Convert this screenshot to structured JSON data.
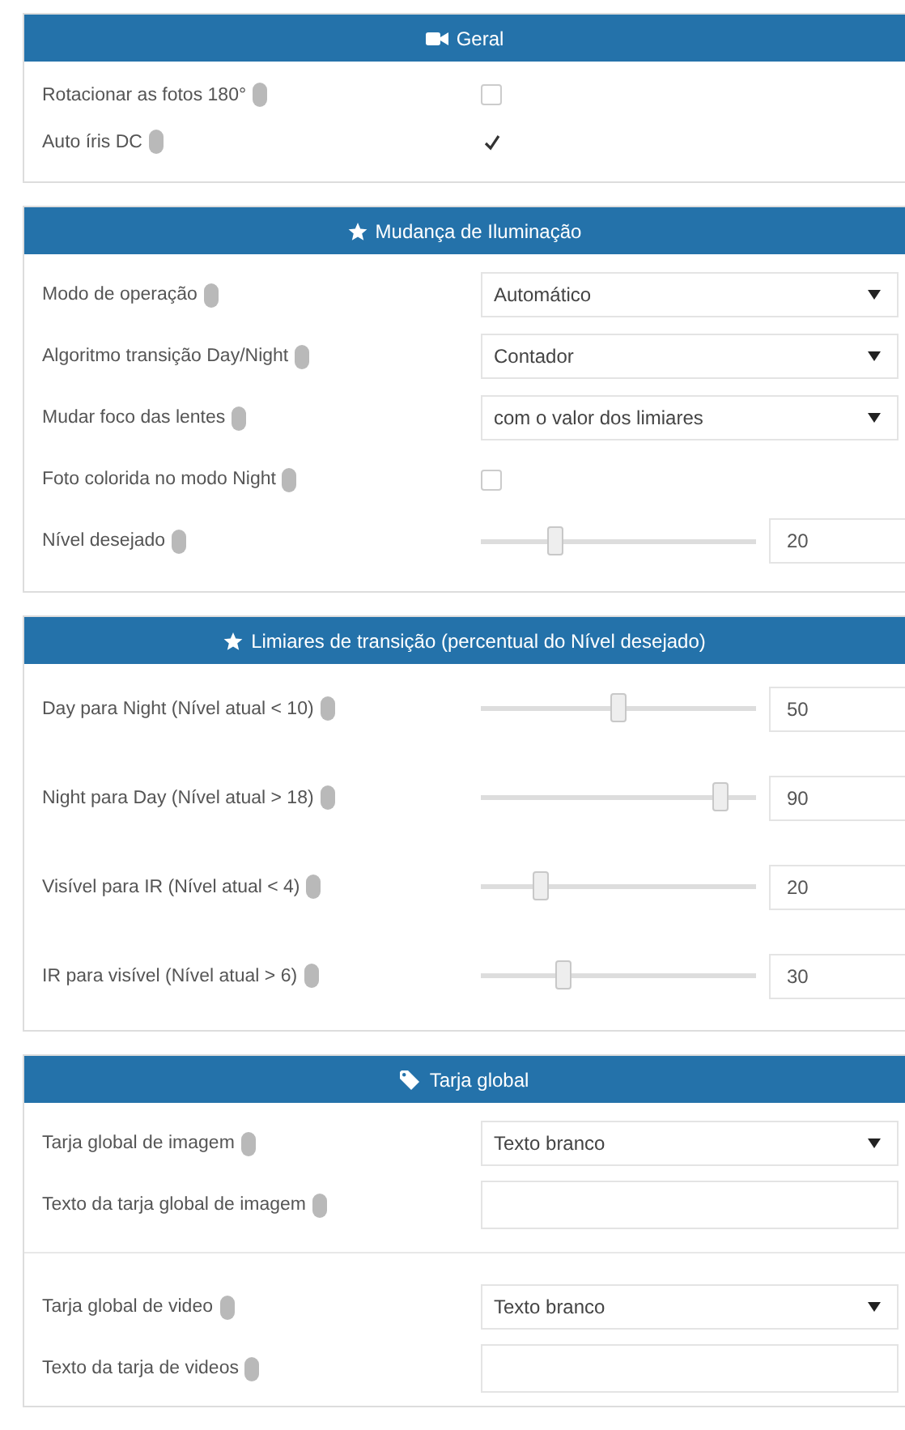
{
  "sections": [
    {
      "title": "Geral",
      "rows": [
        {
          "kind": "checkbox",
          "label": "Rotacionar as fotos 180°",
          "checked": false
        },
        {
          "kind": "checkbox",
          "label": "Auto íris DC",
          "checked": true
        }
      ]
    },
    {
      "title": "Mudança de Iluminação",
      "rows": [
        {
          "kind": "select",
          "label": "Modo de operação",
          "value": "Automático"
        },
        {
          "kind": "select",
          "label": "Algoritmo transição Day/Night",
          "value": "Contador"
        },
        {
          "kind": "select",
          "label": "Mudar foco das lentes",
          "value": "com o valor dos limiares"
        },
        {
          "kind": "checkbox",
          "label": "Foto colorida no modo Night",
          "checked": false
        },
        {
          "kind": "slider",
          "label": "Nível desejado",
          "level": 0.27,
          "value": "20"
        }
      ]
    },
    {
      "title": "Limiares de transição (percentual do Nível desejado)",
      "rows": [
        {
          "kind": "slider",
          "label": "Day para Night (Nível atual < 10)",
          "level": 0.5,
          "value": "50"
        },
        {
          "kind": "slider",
          "label": "Night para Day (Nível atual > 18)",
          "level": 0.87,
          "value": "90"
        },
        {
          "kind": "slider",
          "label": "Visível para IR (Nível atual < 4)",
          "level": 0.22,
          "value": "20"
        },
        {
          "kind": "slider",
          "label": "IR para visível (Nível atual > 6)",
          "level": 0.3,
          "value": "30"
        }
      ]
    },
    {
      "title": "Tarja global",
      "rows": [
        {
          "kind": "select",
          "label": "Tarja global de imagem",
          "value": "Texto branco"
        },
        {
          "kind": "text",
          "label": "Texto da tarja global de imagem"
        },
        {
          "kind": "divider"
        },
        {
          "kind": "select",
          "label": "Tarja global de video",
          "value": "Texto branco"
        },
        {
          "kind": "text",
          "label": "Texto da tarja de videos"
        }
      ]
    }
  ]
}
